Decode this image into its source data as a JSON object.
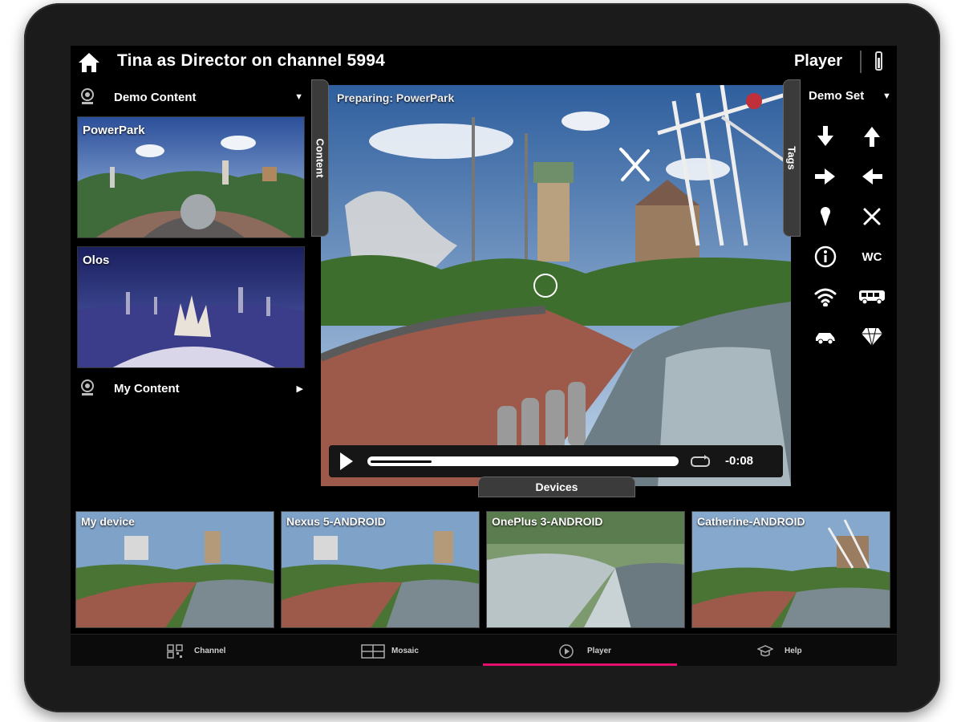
{
  "header": {
    "title": "Tina as Director on channel 5994",
    "mode": "Player"
  },
  "left_panel": {
    "section_demo": "Demo Content",
    "section_mine": "My Content",
    "side_tab": "Content",
    "videos": [
      {
        "label": "PowerPark"
      },
      {
        "label": "Olos"
      }
    ]
  },
  "player": {
    "status": "Preparing: PowerPark",
    "time_remaining": "-0:08",
    "progress": 0.2,
    "devices_tab": "Devices"
  },
  "tags_panel": {
    "side_tab": "Tags",
    "set_name": "Demo Set",
    "buttons": [
      {
        "icon": "arrow-down-icon"
      },
      {
        "icon": "arrow-up-icon"
      },
      {
        "icon": "arrow-right-icon"
      },
      {
        "icon": "arrow-left-icon"
      },
      {
        "icon": "location-pin-icon"
      },
      {
        "icon": "restaurant-icon"
      },
      {
        "icon": "info-icon"
      },
      {
        "icon": "wc-icon",
        "text": "WC"
      },
      {
        "icon": "wifi-icon"
      },
      {
        "icon": "bus-icon"
      },
      {
        "icon": "car-icon"
      },
      {
        "icon": "diamond-icon"
      }
    ]
  },
  "devices": [
    {
      "label": "My device"
    },
    {
      "label": "Nexus 5-ANDROID"
    },
    {
      "label": "OnePlus 3-ANDROID"
    },
    {
      "label": "Catherine-ANDROID"
    }
  ],
  "bottom_nav": [
    {
      "label": "Channel",
      "icon": "qr-code-icon"
    },
    {
      "label": "Mosaic",
      "icon": "mosaic-icon"
    },
    {
      "label": "Player",
      "icon": "player-icon",
      "active": true
    },
    {
      "label": "Help",
      "icon": "graduation-cap-icon"
    }
  ],
  "colors": {
    "accent": "#e3106e",
    "background": "#000000",
    "panel": "#3b3b3b"
  }
}
